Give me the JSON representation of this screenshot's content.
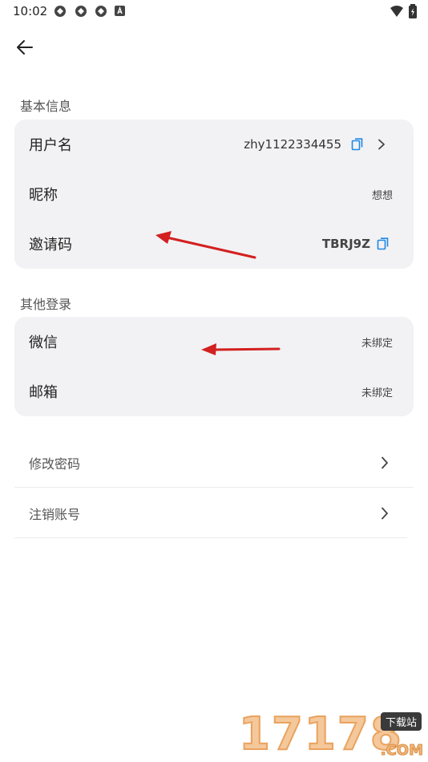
{
  "status_bar": {
    "time": "10:02",
    "icons": [
      "sync-icon",
      "sync-icon",
      "sync-icon",
      "a-badge-icon"
    ],
    "right_icons": [
      "wifi-icon",
      "battery-icon"
    ]
  },
  "nav": {
    "back_icon": "arrow-left-icon"
  },
  "basic_info": {
    "title": "基本信息",
    "rows": [
      {
        "label": "用户名",
        "value": "zhy1122334455",
        "has_copy": true,
        "has_chevron": true
      },
      {
        "label": "昵称",
        "value": "想想"
      },
      {
        "label": "邀请码",
        "value": "TBRJ9Z",
        "has_copy": true
      }
    ]
  },
  "other_login": {
    "title": "其他登录",
    "rows": [
      {
        "label": "微信",
        "value": "未绑定"
      },
      {
        "label": "邮箱",
        "value": "未绑定"
      }
    ]
  },
  "actions": [
    {
      "label": "修改密码"
    },
    {
      "label": "注销账号"
    }
  ],
  "watermark": {
    "numbers": "17178",
    "badge": "下载站",
    "suffix": ".COM"
  },
  "colors": {
    "accent": "#1e88e5",
    "annotation_arrow": "#d32020",
    "card_bg": "#f2f2f4"
  }
}
